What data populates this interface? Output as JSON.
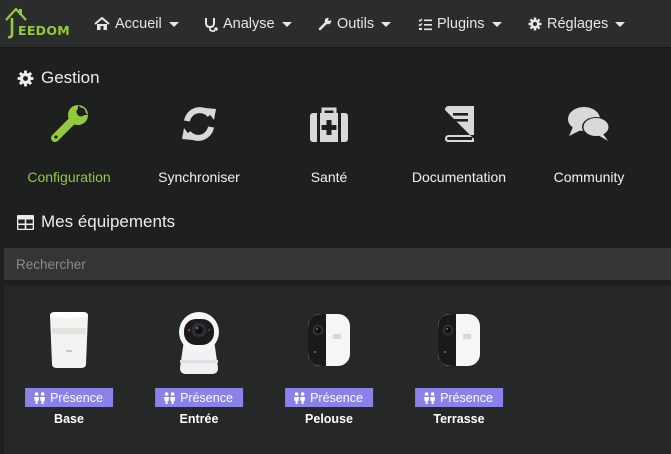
{
  "navbar": {
    "logo_text": "EEDOM",
    "items": [
      {
        "label": "Accueil",
        "icon": "home-icon"
      },
      {
        "label": "Analyse",
        "icon": "stethoscope-icon"
      },
      {
        "label": "Outils",
        "icon": "wrench-icon"
      },
      {
        "label": "Plugins",
        "icon": "tasks-icon"
      },
      {
        "label": "Réglages",
        "icon": "cog-icon"
      }
    ]
  },
  "gestion": {
    "title": "Gestion",
    "tiles": [
      {
        "label": "Configuration",
        "icon": "wrench-icon",
        "active": true
      },
      {
        "label": "Synchroniser",
        "icon": "sync-icon"
      },
      {
        "label": "Santé",
        "icon": "medkit-icon"
      },
      {
        "label": "Documentation",
        "icon": "book-icon"
      },
      {
        "label": "Community",
        "icon": "comments-icon"
      }
    ]
  },
  "equipements": {
    "title": "Mes équipements",
    "search_placeholder": "Rechercher",
    "items": [
      {
        "name": "Base",
        "badge": "Présence",
        "icon": "homebase-device"
      },
      {
        "name": "Entrée",
        "badge": "Présence",
        "icon": "indoor-camera-device"
      },
      {
        "name": "Pelouse",
        "badge": "Présence",
        "icon": "outdoor-camera-device"
      },
      {
        "name": "Terrasse",
        "badge": "Présence",
        "icon": "outdoor-camera-device"
      }
    ]
  },
  "colors": {
    "accent": "#94c93d",
    "badge": "#8a82e8",
    "background": "#1e1f1f",
    "navbar": "#2b2c2c"
  }
}
